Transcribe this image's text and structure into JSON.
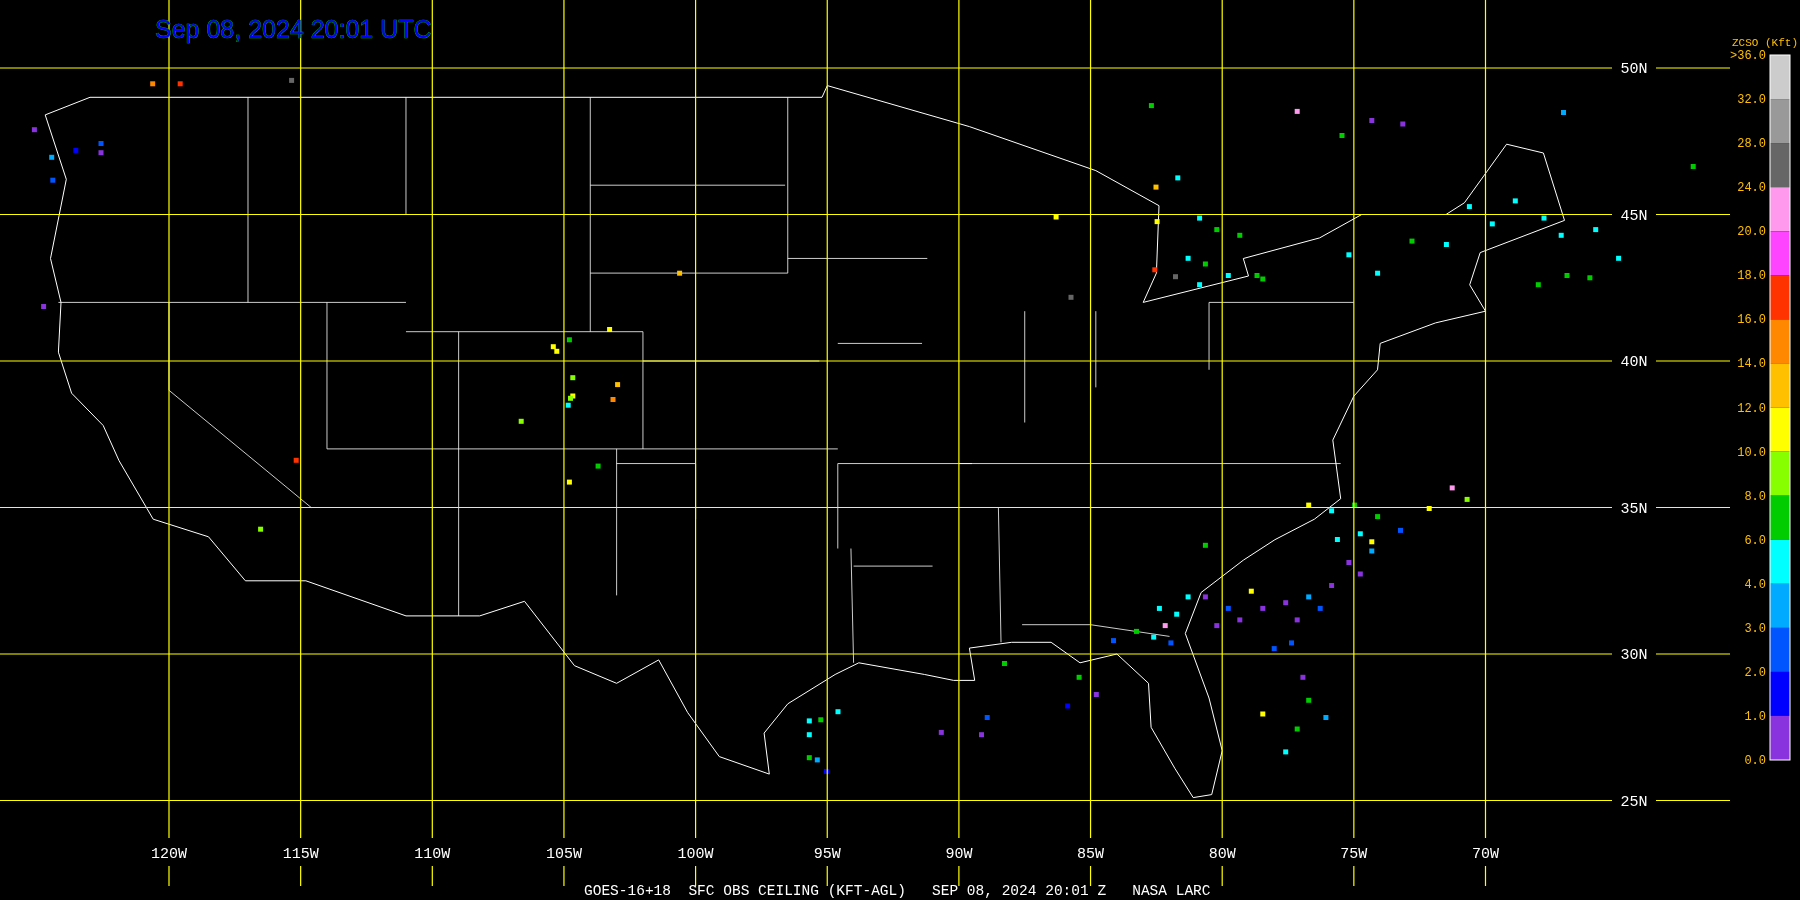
{
  "title": "Sep 08, 2024 20:01 UTC",
  "map": {
    "longitude_labels": [
      "120W",
      "115W",
      "110W",
      "105W",
      "100W",
      "95W",
      "90W",
      "85W",
      "80W",
      "75W",
      "70W"
    ],
    "latitude_labels": [
      "50N",
      "45N",
      "40N",
      "35N",
      "30N",
      "25N"
    ]
  },
  "legend": {
    "title": "ZCSO (Kft)",
    "labels": [
      ">36.0",
      "32.0",
      "28.0",
      "24.0",
      "20.0",
      "18.0",
      "16.0",
      "14.0",
      "12.0",
      "10.0",
      "8.0",
      "6.0",
      "4.0",
      "3.0",
      "2.0",
      "1.0",
      "0.0"
    ],
    "segments": [
      {
        "color": "#cccccc"
      },
      {
        "color": "#999999"
      },
      {
        "color": "#666666"
      },
      {
        "color": "#ff99ee"
      },
      {
        "color": "#ff44ff"
      },
      {
        "color": "#ff3300"
      },
      {
        "color": "#ff8800"
      },
      {
        "color": "#ffc000"
      },
      {
        "color": "#ffff00"
      },
      {
        "color": "#88ff00"
      },
      {
        "color": "#00cc00"
      },
      {
        "color": "#00ffff"
      },
      {
        "color": "#00aaff"
      },
      {
        "color": "#0055ff"
      },
      {
        "color": "#0000ff"
      },
      {
        "color": "#8833dd"
      }
    ]
  },
  "footer": "GOES-16+18  SFC OBS CEILING (KFT-AGL)   SEP 08, 2024 20:01 Z   NASA LARC"
}
